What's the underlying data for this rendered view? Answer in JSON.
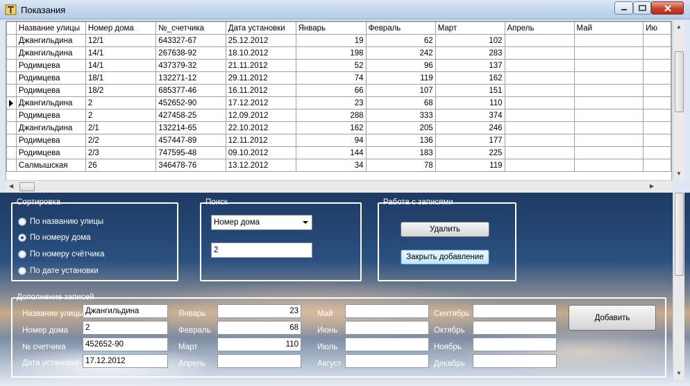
{
  "window": {
    "title": "Показания"
  },
  "grid": {
    "columns": [
      "Название улицы",
      "Номер дома",
      "№_счетчика",
      "Дата установки",
      "Январь",
      "Февраль",
      "Март",
      "Апрель",
      "Май",
      "Ию"
    ],
    "rows": [
      [
        "Джангильдина",
        "12/1",
        "643327-67",
        "25.12.2012",
        "19",
        "62",
        "102",
        "",
        "",
        ""
      ],
      [
        "Джангильдина",
        "14/1",
        "267638-92",
        "18.10.2012",
        "198",
        "242",
        "283",
        "",
        "",
        ""
      ],
      [
        "Родимцева",
        "14/1",
        "437379-32",
        "21.11.2012",
        "52",
        "96",
        "137",
        "",
        "",
        ""
      ],
      [
        "Родимцева",
        "18/1",
        "132271-12",
        "29.11.2012",
        "74",
        "119",
        "162",
        "",
        "",
        ""
      ],
      [
        "Родимцева",
        "18/2",
        "685377-46",
        "16.11.2012",
        "66",
        "107",
        "151",
        "",
        "",
        ""
      ],
      [
        "Джангильдина",
        "2",
        "452652-90",
        "17.12.2012",
        "23",
        "68",
        "110",
        "",
        "",
        ""
      ],
      [
        "Родимцева",
        "2",
        "427458-25",
        "12.09.2012",
        "288",
        "333",
        "374",
        "",
        "",
        ""
      ],
      [
        "Джангильдина",
        "2/1",
        "132214-65",
        "22.10.2012",
        "162",
        "205",
        "246",
        "",
        "",
        ""
      ],
      [
        "Родимцева",
        "2/2",
        "457447-89",
        "12.11.2012",
        "94",
        "136",
        "177",
        "",
        "",
        ""
      ],
      [
        "Родимцева",
        "2/3",
        "747595-48",
        "09.10.2012",
        "144",
        "183",
        "225",
        "",
        "",
        ""
      ],
      [
        "Салмышская",
        "26",
        "346478-76",
        "13.12.2012",
        "34",
        "78",
        "119",
        "",
        "",
        ""
      ]
    ],
    "current_row": 5
  },
  "sort": {
    "title": "Сортировка",
    "options": [
      "По названию улицы",
      "По номеру дома",
      "По номеру счётчика",
      "По дате установки"
    ],
    "selected": 1
  },
  "search": {
    "title": "Поиск",
    "field": "Номер дома",
    "value": "2"
  },
  "records": {
    "title": "Работа с записями",
    "delete_label": "Удалить",
    "close_add_label": "Закрыть добавление"
  },
  "add": {
    "title": "Дополнение записей",
    "street_label": "Название улицы",
    "street_value": "Джангильдина",
    "house_label": "Номер дома",
    "house_value": "2",
    "meter_label": "№ счетчика",
    "meter_value": "452652-90",
    "date_label": "Дата установки",
    "date_value": "17.12.2012",
    "months": [
      {
        "label": "Январь",
        "value": "23"
      },
      {
        "label": "Февраль",
        "value": "68"
      },
      {
        "label": "Март",
        "value": "110"
      },
      {
        "label": "Апрель",
        "value": ""
      },
      {
        "label": "Май",
        "value": ""
      },
      {
        "label": "Июнь",
        "value": ""
      },
      {
        "label": "Июль",
        "value": ""
      },
      {
        "label": "Август",
        "value": ""
      },
      {
        "label": "Сентябрь",
        "value": ""
      },
      {
        "label": "Октябрь",
        "value": ""
      },
      {
        "label": "Ноябрь",
        "value": ""
      },
      {
        "label": "Декабрь",
        "value": ""
      }
    ],
    "add_label": "Добавить"
  }
}
